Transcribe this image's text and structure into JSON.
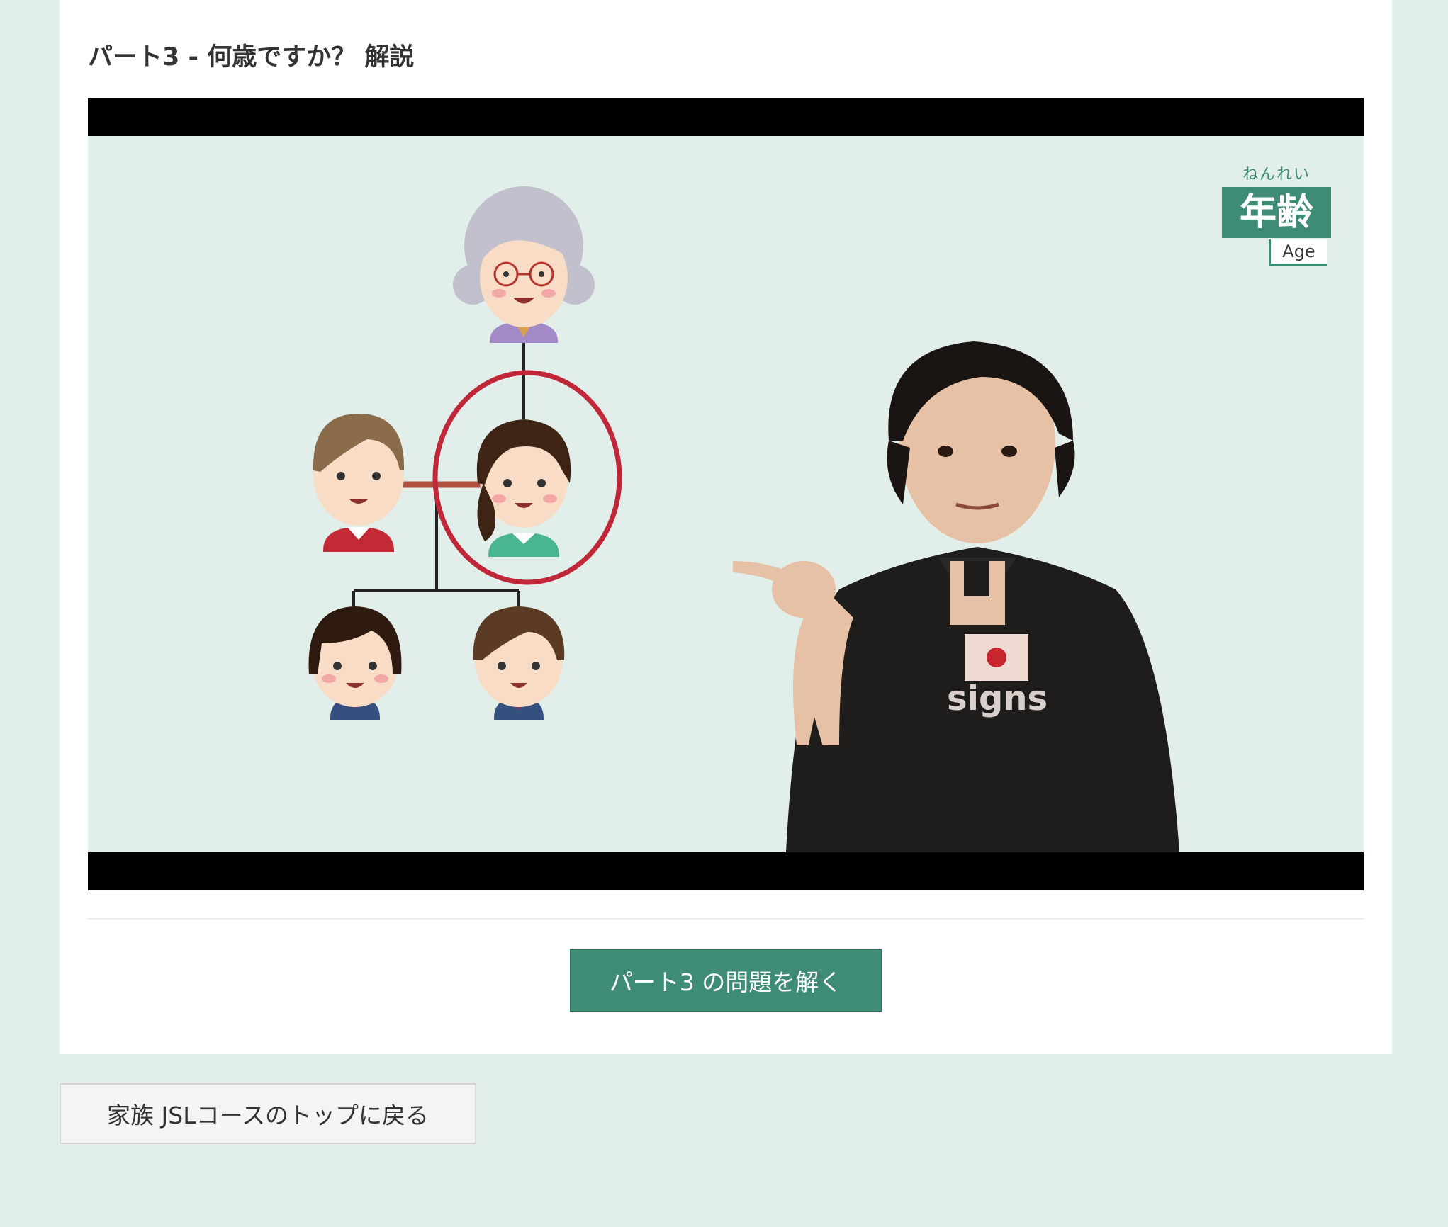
{
  "section": {
    "title": "パート3 - 何歳ですか？ 解説"
  },
  "video": {
    "topic_ruby": "ねんれい",
    "topic_kanji": "年齢",
    "topic_english": "Age",
    "shirt_logo": "signs"
  },
  "actions": {
    "solve_label": "パート3 の問題を解く",
    "back_label": "家族 JSLコースのトップに戻る"
  },
  "colors": {
    "accent": "#3e8b76",
    "page_background": "#e2eeeb",
    "highlight_ring": "#c0283a"
  }
}
